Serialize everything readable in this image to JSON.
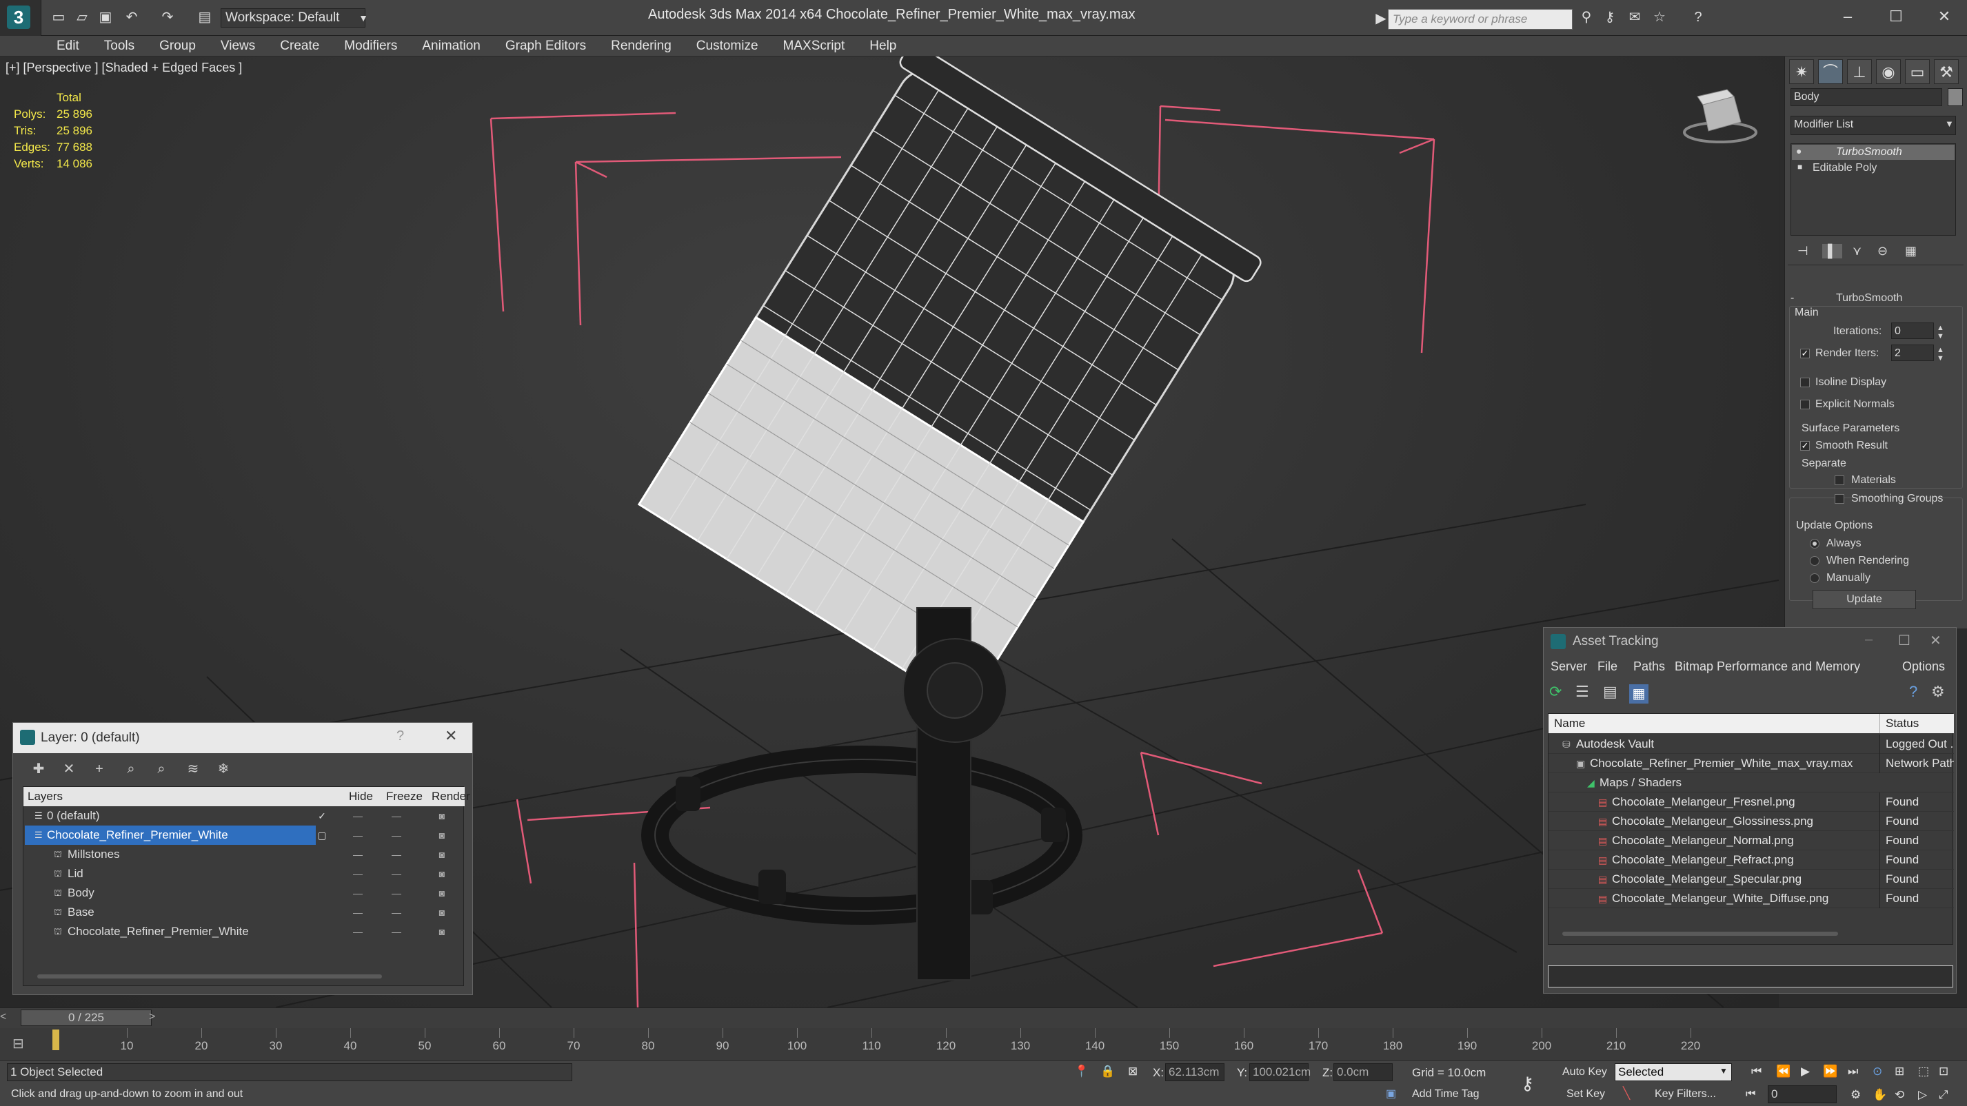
{
  "app": {
    "title": "Autodesk 3ds Max  2014 x64      Chocolate_Refiner_Premier_White_max_vray.max",
    "workspace": "Workspace: Default",
    "search_placeholder": "Type a keyword or phrase"
  },
  "menu": [
    "Edit",
    "Tools",
    "Group",
    "Views",
    "Create",
    "Modifiers",
    "Animation",
    "Graph Editors",
    "Rendering",
    "Customize",
    "MAXScript",
    "Help"
  ],
  "viewport": {
    "label": "[+] [Perspective ] [Shaded + Edged Faces ]",
    "stats": {
      "header": "Total",
      "rows": [
        {
          "label": "Polys:",
          "value": "25 896"
        },
        {
          "label": "Tris:",
          "value": "25 896"
        },
        {
          "label": "Edges:",
          "value": "77 688"
        },
        {
          "label": "Verts:",
          "value": "14 086"
        }
      ]
    }
  },
  "command_panel": {
    "object_name": "Body",
    "modifier_list": "Modifier List",
    "stack": [
      "TurboSmooth",
      "Editable Poly"
    ],
    "rollout_title": "TurboSmooth",
    "main": "Main",
    "iterations_label": "Iterations:",
    "iterations_value": "0",
    "render_iters_label": "Render Iters:",
    "render_iters_value": "2",
    "isoline": "Isoline Display",
    "explicit_normals": "Explicit Normals",
    "surface_params": "Surface Parameters",
    "smooth_result": "Smooth Result",
    "separate": "Separate",
    "materials": "Materials",
    "smoothing_groups": "Smoothing Groups",
    "update_options": "Update Options",
    "always": "Always",
    "when_rendering": "When Rendering",
    "manually": "Manually",
    "update_button": "Update"
  },
  "layer_dialog": {
    "title": "Layer: 0 (default)",
    "help": "?",
    "columns": {
      "layers": "Layers",
      "hide": "Hide",
      "freeze": "Freeze",
      "render": "Render"
    },
    "rows": [
      {
        "name": "0 (default)",
        "indent": 1
      },
      {
        "name": "Chocolate_Refiner_Premier_White",
        "indent": 1
      },
      {
        "name": "Millstones",
        "indent": 2
      },
      {
        "name": "Lid",
        "indent": 2
      },
      {
        "name": "Body",
        "indent": 2
      },
      {
        "name": "Base",
        "indent": 2
      },
      {
        "name": "Chocolate_Refiner_Premier_White",
        "indent": 2
      }
    ]
  },
  "asset_dialog": {
    "title": "Asset Tracking",
    "menu": [
      "Server",
      "File",
      "Paths",
      "Bitmap Performance and Memory",
      "Options"
    ],
    "columns": {
      "name": "Name",
      "status": "Status"
    },
    "rows": [
      {
        "name": "Autodesk Vault",
        "status": "Logged Out ..."
      },
      {
        "name": "Chocolate_Refiner_Premier_White_max_vray.max",
        "status": "Network Path"
      },
      {
        "name": "Maps / Shaders",
        "status": ""
      },
      {
        "name": "Chocolate_Melangeur_Fresnel.png",
        "status": "Found"
      },
      {
        "name": "Chocolate_Melangeur_Glossiness.png",
        "status": "Found"
      },
      {
        "name": "Chocolate_Melangeur_Normal.png",
        "status": "Found"
      },
      {
        "name": "Chocolate_Melangeur_Refract.png",
        "status": "Found"
      },
      {
        "name": "Chocolate_Melangeur_Specular.png",
        "status": "Found"
      },
      {
        "name": "Chocolate_Melangeur_White_Diffuse.png",
        "status": "Found"
      }
    ]
  },
  "timeline": {
    "frame": "0 / 225",
    "ticks": [
      "10",
      "20",
      "30",
      "40",
      "50",
      "60",
      "70",
      "80",
      "90",
      "100",
      "110",
      "120",
      "130",
      "140",
      "150",
      "160",
      "170",
      "180",
      "190",
      "200",
      "210",
      "220"
    ]
  },
  "status": {
    "selected": "1 Object Selected",
    "prompt": "Click and drag up-and-down to zoom in and out",
    "x_label": "X:",
    "x_value": "62.113cm",
    "y_label": "Y:",
    "y_value": "100.021cm",
    "z_label": "Z:",
    "z_value": "0.0cm",
    "grid": "Grid = 10.0cm",
    "add_time_tag": "Add Time Tag",
    "auto_key": "Auto Key",
    "set_key": "Set Key",
    "selected_dropdown": "Selected",
    "key_filters": "Key Filters...",
    "frame_field": "0"
  }
}
